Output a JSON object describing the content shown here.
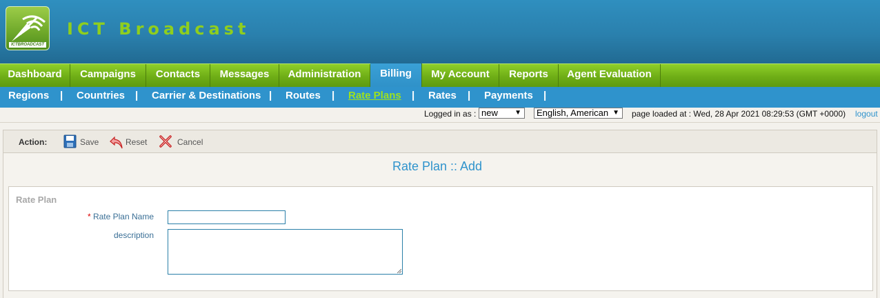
{
  "app": {
    "logo_text": "ICTBROADCAST",
    "title": "ICT Broadcast"
  },
  "main_nav": {
    "tabs": [
      {
        "label": "Dashboard"
      },
      {
        "label": "Campaigns"
      },
      {
        "label": "Contacts"
      },
      {
        "label": "Messages"
      },
      {
        "label": "Administration"
      },
      {
        "label": "Billing",
        "active": true
      },
      {
        "label": "My Account"
      },
      {
        "label": "Reports"
      },
      {
        "label": "Agent Evaluation"
      }
    ]
  },
  "sub_nav": {
    "items": [
      {
        "label": "Regions"
      },
      {
        "label": "Countries"
      },
      {
        "label": "Carrier & Destinations"
      },
      {
        "label": "Routes"
      },
      {
        "label": "Rate Plans",
        "active": true
      },
      {
        "label": "Rates"
      },
      {
        "label": "Payments"
      }
    ],
    "separator": "|"
  },
  "status": {
    "logged_in_label": "Logged in as :",
    "user_value": "new",
    "language_value": "English, American",
    "page_loaded": "page loaded at : Wed, 28 Apr 2021 08:29:53 (GMT +0000)",
    "logout": "logout"
  },
  "actions": {
    "label": "Action:",
    "save": "Save",
    "reset": "Reset",
    "cancel": "Cancel"
  },
  "form": {
    "page_title": "Rate Plan :: Add",
    "legend": "Rate Plan",
    "required_mark": "*",
    "name_label": "Rate Plan Name",
    "name_value": "",
    "description_label": "description",
    "description_value": ""
  },
  "colors": {
    "header_blue": "#2a80ad",
    "nav_green": "#6fae16",
    "subnav_blue": "#2f93cc",
    "title_green": "#8fce1e",
    "active_sub": "#9ee21c"
  }
}
